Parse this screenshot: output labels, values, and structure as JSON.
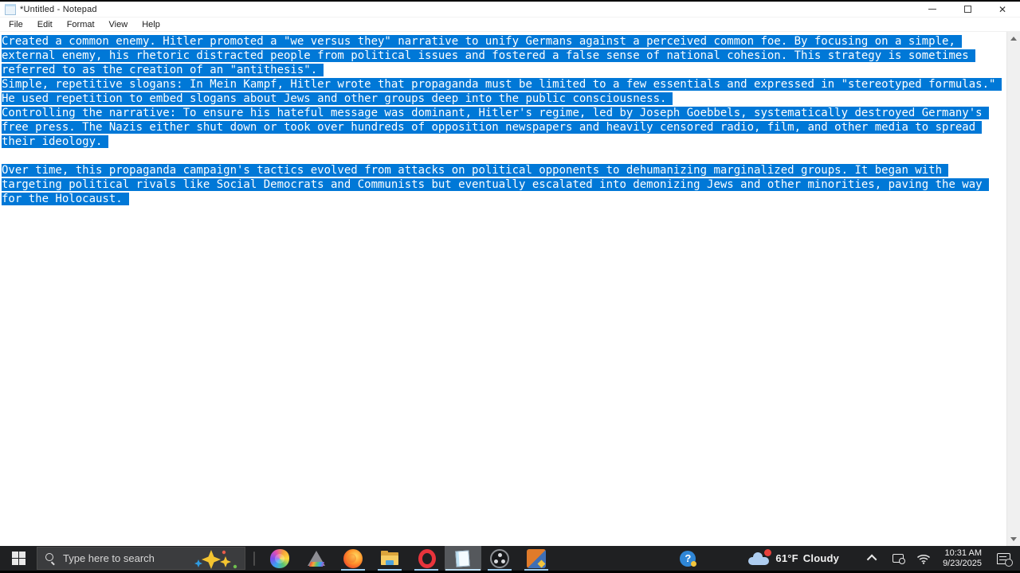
{
  "window": {
    "title": "*Untitled - Notepad",
    "controls": {
      "minimize": "minimize",
      "restore": "restore",
      "close": "close"
    }
  },
  "menu": {
    "items": [
      "File",
      "Edit",
      "Format",
      "View",
      "Help"
    ]
  },
  "editor": {
    "selection_color": "#0078d7",
    "lines": [
      {
        "text": "Created a common enemy. Hitler promoted a \"we versus they\" narrative to unify Germans against a perceived common foe. By focusing on a simple,",
        "selected": true
      },
      {
        "text": "external enemy, his rhetoric distracted people from political issues and fostered a false sense of national cohesion. This strategy is sometimes",
        "selected": true
      },
      {
        "text": "referred to as the creation of an \"antithesis\".",
        "selected": true
      },
      {
        "text": "Simple, repetitive slogans: In Mein Kampf, Hitler wrote that propaganda must be limited to a few essentials and expressed in \"stereotyped formulas.\"",
        "selected": true
      },
      {
        "text": "He used repetition to embed slogans about Jews and other groups deep into the public consciousness.",
        "selected": true
      },
      {
        "text": "Controlling the narrative: To ensure his hateful message was dominant, Hitler's regime, led by Joseph Goebbels, systematically destroyed Germany's",
        "selected": true
      },
      {
        "text": "free press. The Nazis either shut down or took over hundreds of opposition newspapers and heavily censored radio, film, and other media to spread",
        "selected": true
      },
      {
        "text": "their ideology.",
        "selected": true
      },
      {
        "text": "",
        "selected": false
      },
      {
        "text": "Over time, this propaganda campaign's tactics evolved from attacks on political opponents to dehumanizing marginalized groups. It began with",
        "selected": true
      },
      {
        "text": "targeting political rivals like Social Democrats and Communists but eventually escalated into demonizing Jews and other minorities, paving the way",
        "selected": true
      },
      {
        "text": "for the Holocaust.",
        "selected": true
      }
    ]
  },
  "taskbar": {
    "search": {
      "placeholder": "Type here to search"
    },
    "apps": [
      {
        "name": "copilot",
        "running": false,
        "active": false
      },
      {
        "name": "paint-3d",
        "running": false,
        "active": false
      },
      {
        "name": "firefox",
        "running": true,
        "active": false
      },
      {
        "name": "file-explorer",
        "running": true,
        "active": false
      },
      {
        "name": "opera",
        "running": true,
        "active": false
      },
      {
        "name": "notepad-app",
        "running": true,
        "active": true
      },
      {
        "name": "obs",
        "running": true,
        "active": false
      },
      {
        "name": "unknown-app",
        "running": true,
        "active": false
      }
    ],
    "tray": {
      "weather_temp": "61°F",
      "weather_condition": "Cloudy",
      "time": "10:31 AM",
      "date": "9/23/2025"
    }
  }
}
